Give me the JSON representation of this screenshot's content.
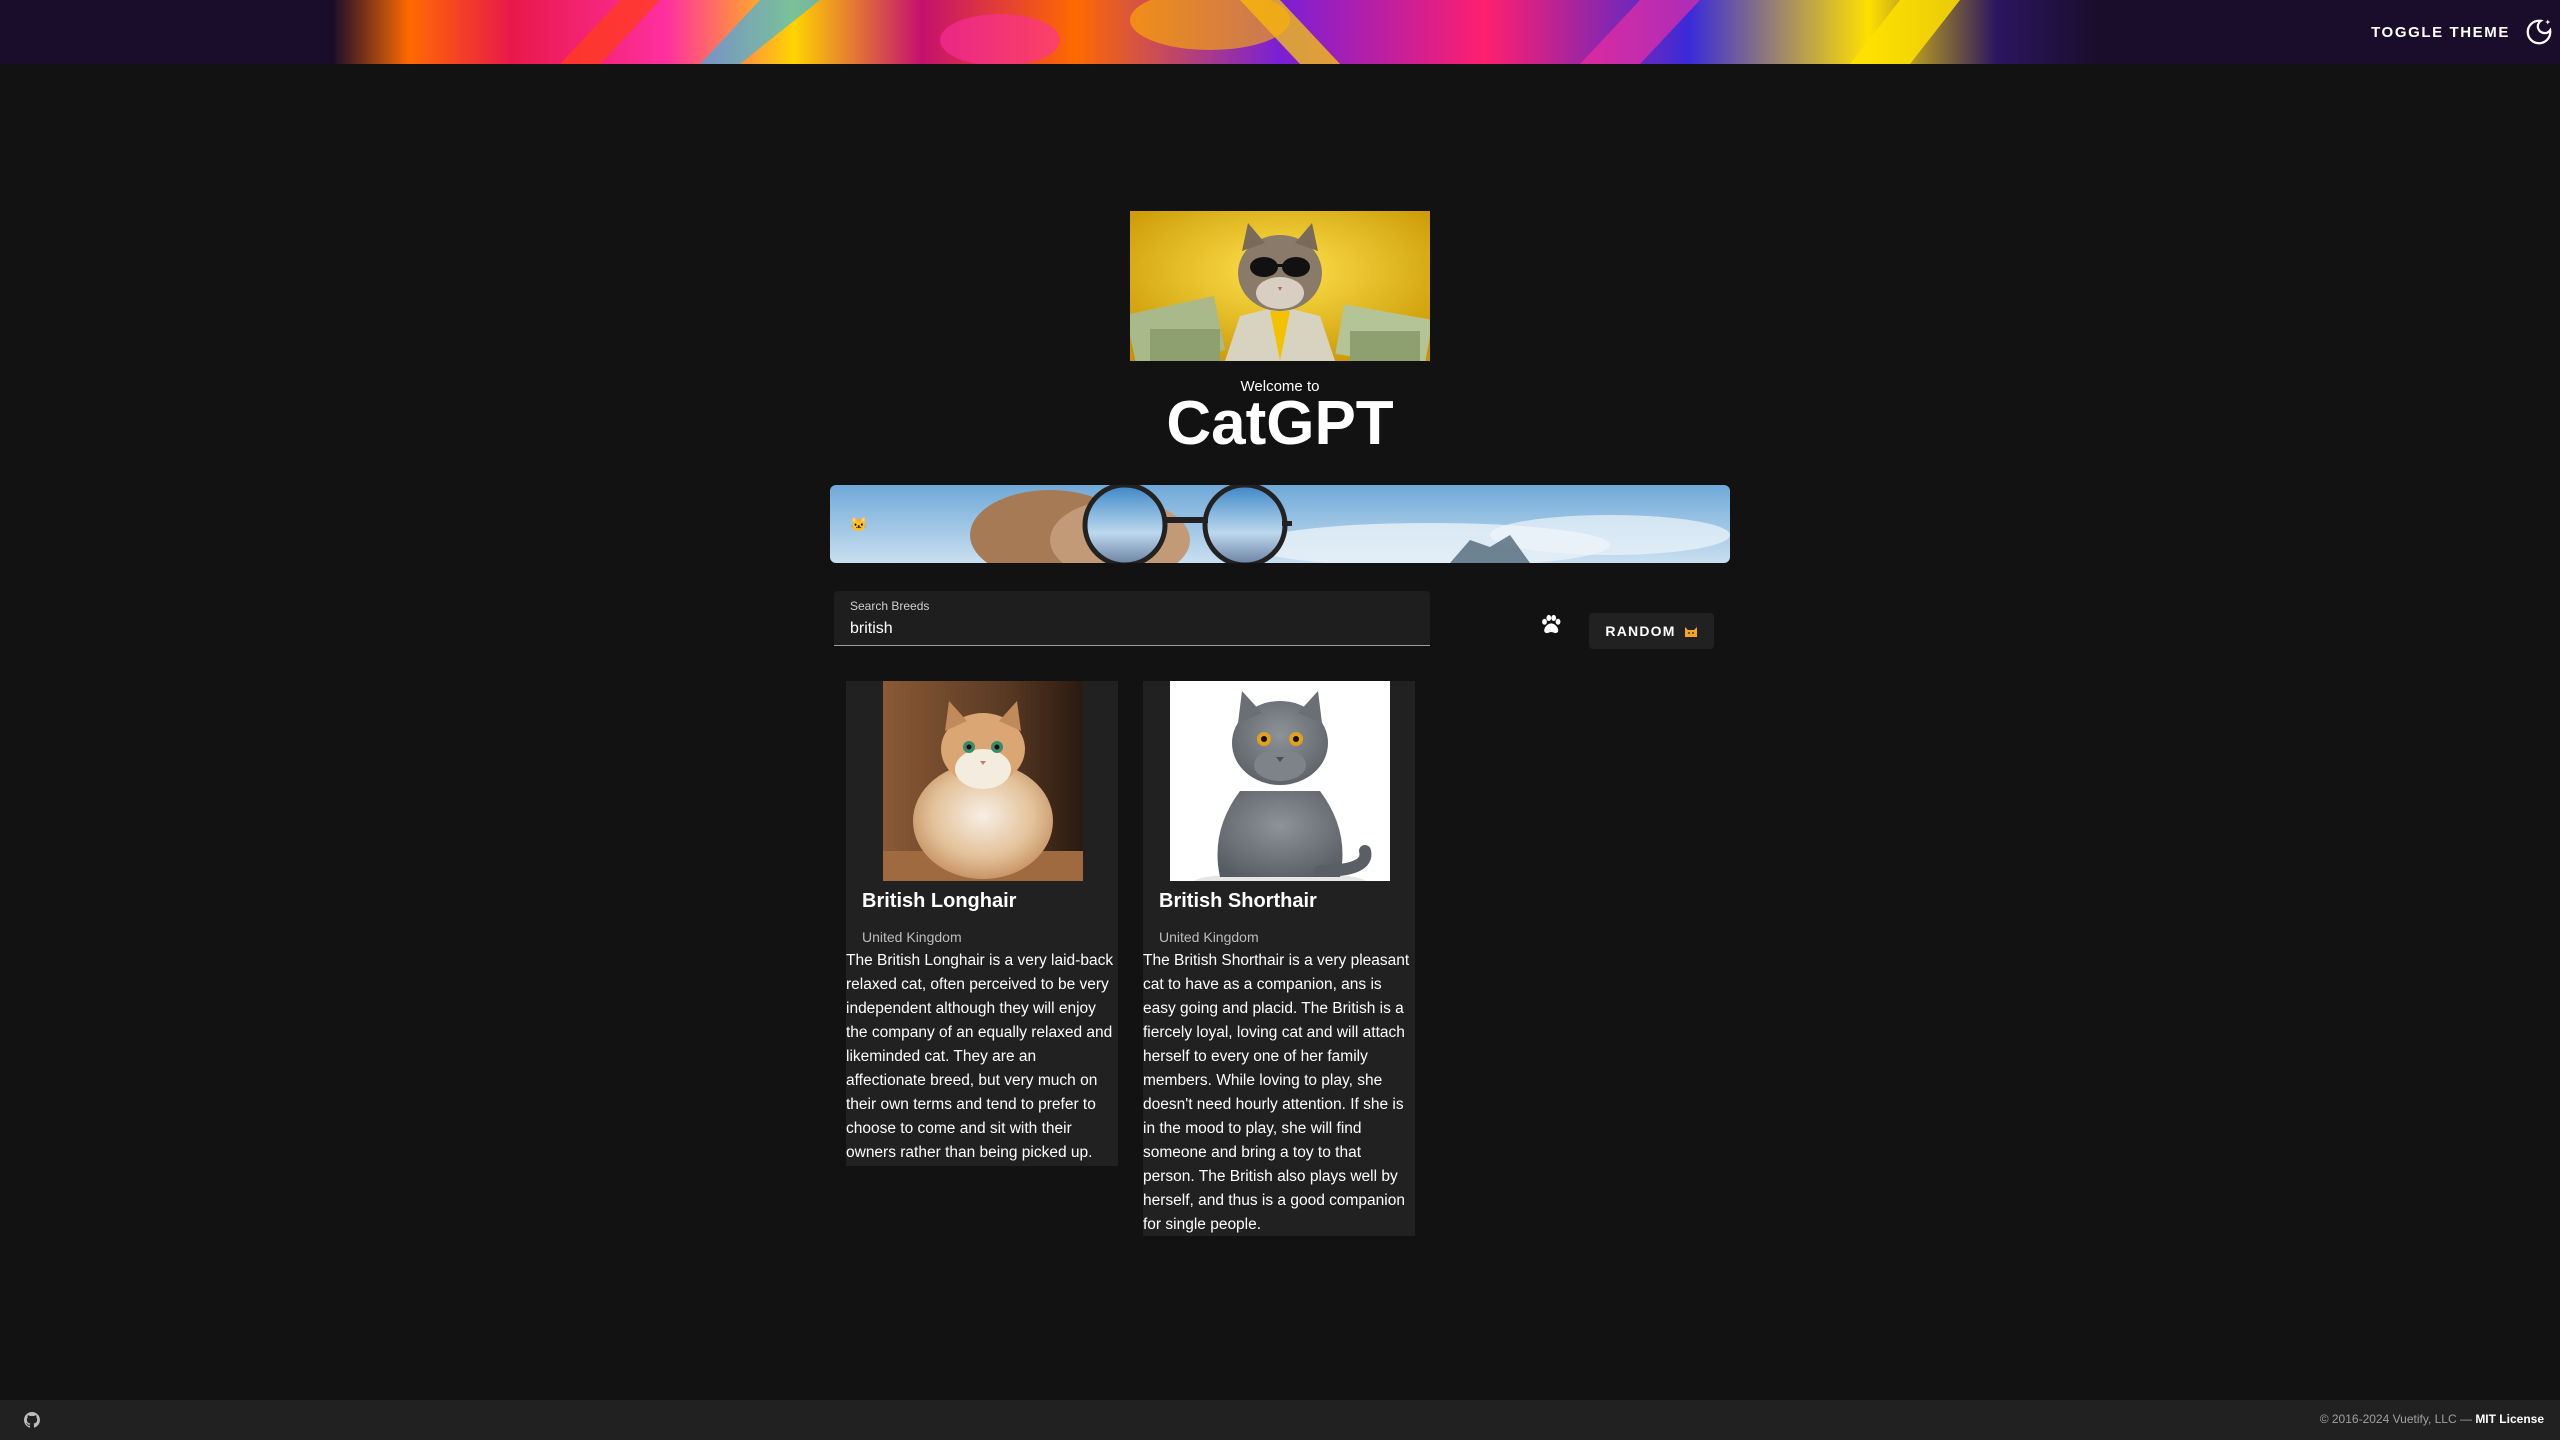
{
  "header": {
    "theme_toggle_label": "TOGGLE THEME",
    "theme_icon": "theme-light-dark-icon"
  },
  "hero": {
    "welcome": "Welcome to",
    "title": "CatGPT",
    "image": "cat-in-sunglasses-with-money"
  },
  "banner": {
    "image": "cat-sunglasses-sky-banner"
  },
  "search": {
    "label": "Search Breeds",
    "value": "british"
  },
  "actions": {
    "paw_icon": "paw-icon",
    "random_label": "RANDOM"
  },
  "breeds": [
    {
      "name": "British Longhair",
      "origin": "United Kingdom",
      "description": "The British Longhair is a very laid-back relaxed cat, often perceived to be very independent although they will enjoy the company of an equally relaxed and likeminded cat. They are an affectionate breed, but very much on their own terms and tend to prefer to choose to come and sit with their owners rather than being picked up."
    },
    {
      "name": "British Shorthair",
      "origin": "United Kingdom",
      "description": "The British Shorthair is a very pleasant cat to have as a companion, ans is easy going and placid. The British is a fiercely loyal, loving cat and will attach herself to every one of her family members. While loving to play, she doesn't need hourly attention. If she is in the mood to play, she will find someone and bring a toy to that person. The British also plays well by herself, and thus is a good companion for single people."
    }
  ],
  "footer": {
    "copyright": "© 2016-2024 Vuetify, LLC —",
    "license": "MIT License",
    "github_icon": "github-icon"
  },
  "colors": {
    "background": "#121212",
    "surface": "#212121",
    "text": "#ffffff"
  }
}
